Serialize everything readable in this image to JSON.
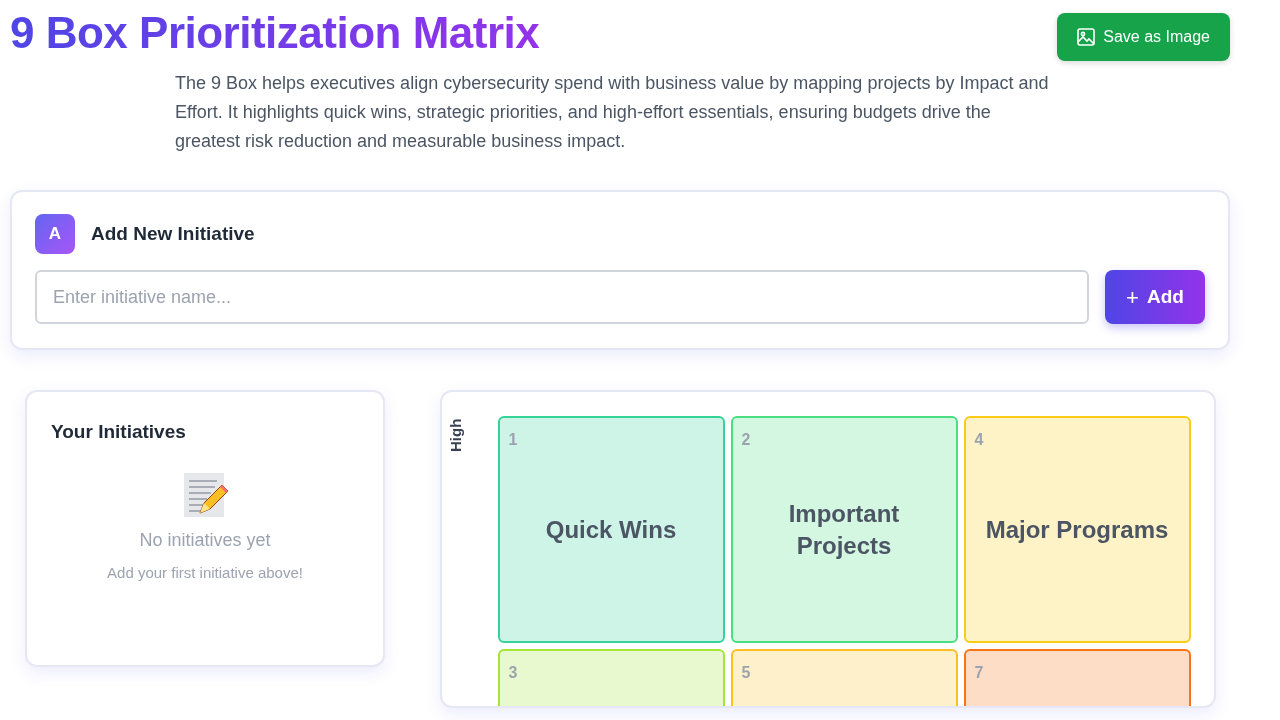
{
  "header": {
    "title": "9 Box Prioritization Matrix",
    "save_button": "Save as Image",
    "description": "The 9 Box helps executives align cybersecurity spend with business value by mapping projects by Impact and Effort. It highlights quick wins, strategic priorities, and high-effort essentials, ensuring budgets drive the greatest risk reduction and measurable business impact."
  },
  "add_panel": {
    "badge": "A",
    "title": "Add New Initiative",
    "input": {
      "placeholder": "Enter initiative name..."
    },
    "add_button": {
      "icon": "+",
      "label": "Add"
    }
  },
  "initiatives_panel": {
    "title": "Your Initiatives",
    "empty_title": "No initiatives yet",
    "empty_hint": "Add your first initiative above!"
  },
  "matrix": {
    "y_axis_label": "High",
    "cells": [
      {
        "number": "1",
        "label": "Quick Wins",
        "color": "#34d399"
      },
      {
        "number": "2",
        "label": "Important Projects",
        "color": "#4ade80"
      },
      {
        "number": "4",
        "label": "Major Programs",
        "color": "#facc15"
      },
      {
        "number": "3",
        "color": "#a3e635"
      },
      {
        "number": "5",
        "color": "#fbbf24"
      },
      {
        "number": "7",
        "color": "#f97316"
      }
    ]
  }
}
